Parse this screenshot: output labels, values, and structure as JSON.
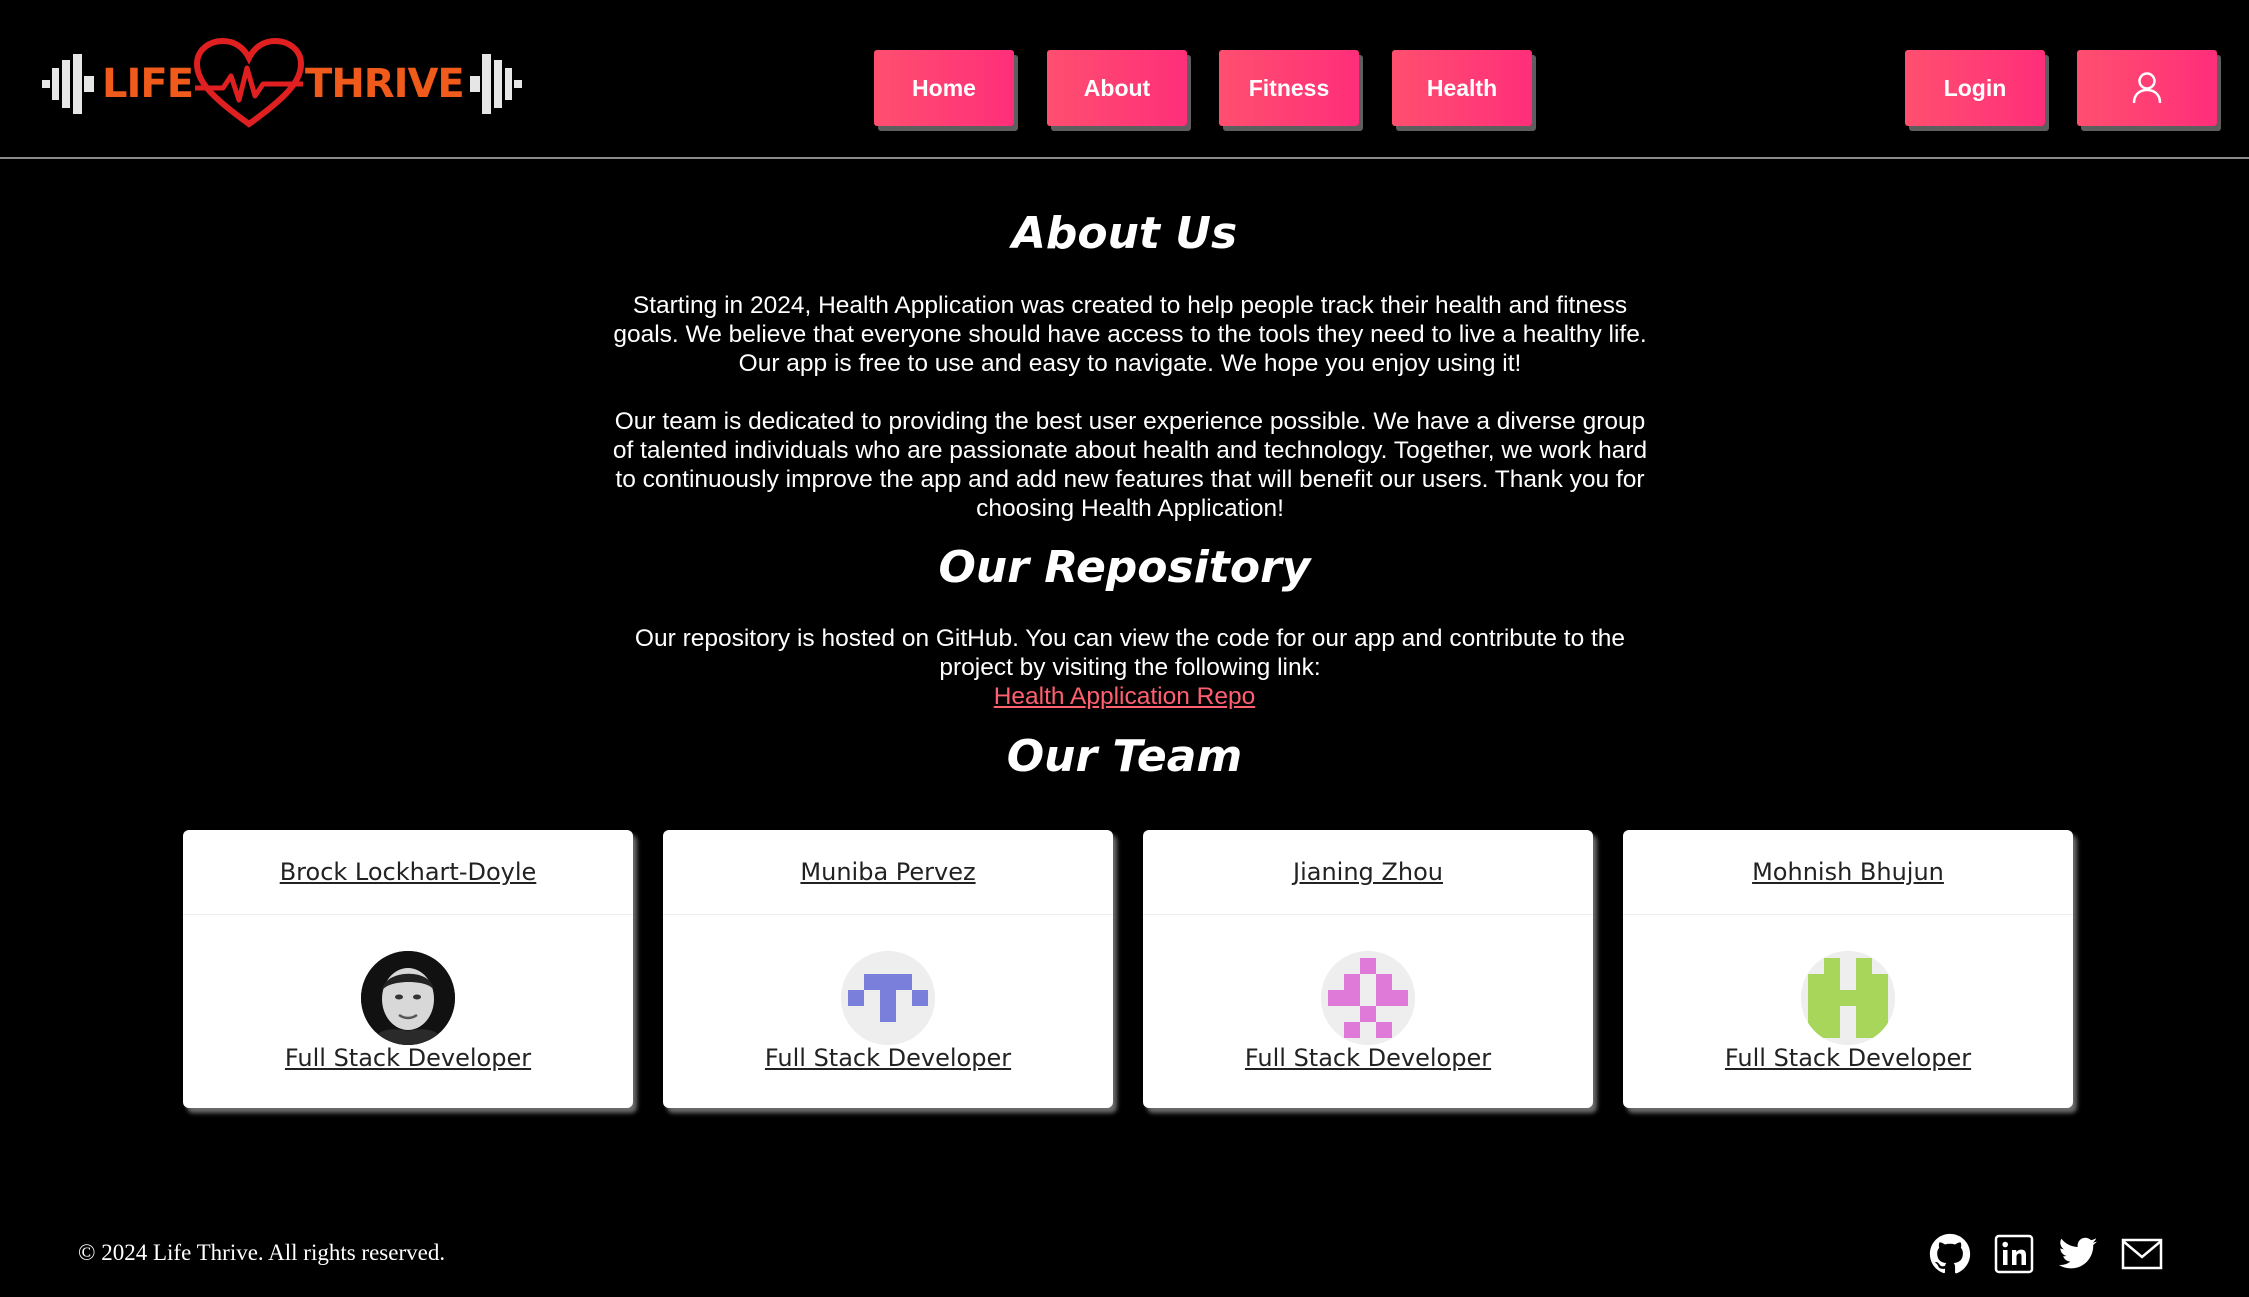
{
  "header": {
    "logo": {
      "word_left": "LIFE",
      "word_right": "THRIVE",
      "color": "#f05a1a",
      "heart_color": "#e02020"
    },
    "nav": [
      {
        "label": "Home"
      },
      {
        "label": "About"
      },
      {
        "label": "Fitness"
      },
      {
        "label": "Health"
      }
    ],
    "login_label": "Login",
    "profile_icon": "user-icon",
    "accent": "#ff3f74"
  },
  "about": {
    "title": "About Us",
    "paragraph1": "Starting in 2024, Health Application was created to help people track their health and fitness goals. We believe that everyone should have access to the tools they need to live a healthy life. Our app is free to use and easy to navigate. We hope you enjoy using it!",
    "paragraph2": "Our team is dedicated to providing the best user experience possible. We have a diverse group of talented individuals who are passionate about health and technology. Together, we work hard to continuously improve the app and add new features that will benefit our users. Thank you for choosing Health Application!"
  },
  "repository": {
    "title": "Our Repository",
    "text": "Our repository is hosted on GitHub. You can view the code for our app and contribute to the project by visiting the following link:",
    "link_label": "Health Application Repo",
    "link_color": "#ff5f70"
  },
  "team": {
    "title": "Our Team",
    "members": [
      {
        "name": "Brock Lockhart-Doyle",
        "role": "Full Stack Developer",
        "avatar": "photo"
      },
      {
        "name": "Muniba Pervez",
        "role": "Full Stack Developer",
        "avatar": "identicon",
        "avatar_color": "#7b7fdc"
      },
      {
        "name": "Jianing Zhou",
        "role": "Full Stack Developer",
        "avatar": "identicon",
        "avatar_color": "#e07ad8"
      },
      {
        "name": "Mohnish Bhujun",
        "role": "Full Stack Developer",
        "avatar": "identicon",
        "avatar_color": "#a8d65a"
      }
    ]
  },
  "footer": {
    "copyright": "© 2024 Life Thrive. All rights reserved.",
    "social_icons": [
      "github-icon",
      "linkedin-icon",
      "twitter-icon",
      "mail-icon"
    ]
  }
}
